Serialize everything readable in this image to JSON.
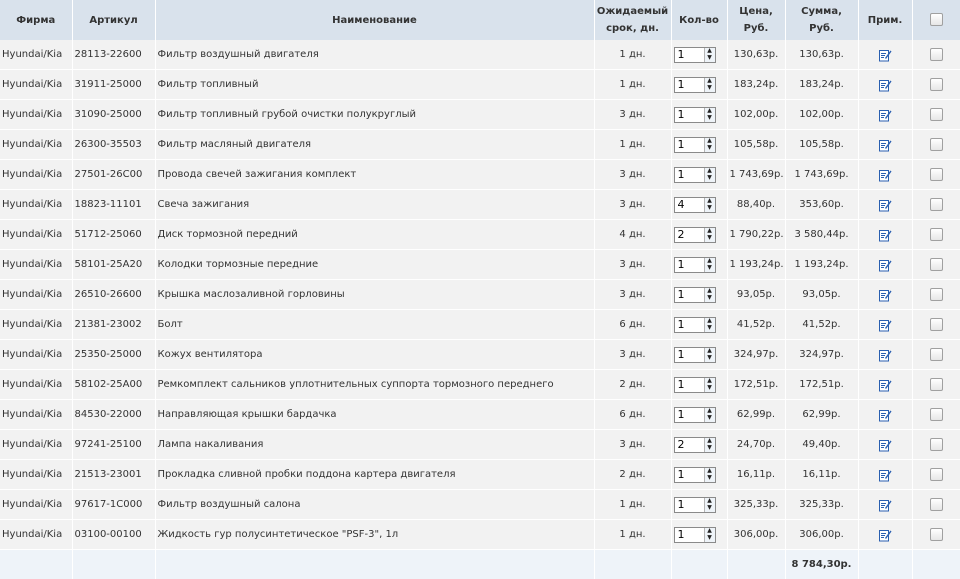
{
  "headers": {
    "firm": "Фирма",
    "article": "Артикул",
    "name": "Наименование",
    "days_line1": "Ожидаемый",
    "days_line2": "срок, дн.",
    "qty": "Кол-во",
    "price_line1": "Цена,",
    "price_line2": "Руб.",
    "sum": "Сумма, Руб.",
    "note": "Прим."
  },
  "icons": {
    "note": "edit-note-icon",
    "stepper_up": "arrow-up-icon",
    "stepper_down": "arrow-down-icon"
  },
  "colors": {
    "header_bg": "#d9e2ec",
    "row_bg": "#f2f2f2",
    "footer_bg": "#eef3f9",
    "icon_blue": "#2a5fb0"
  },
  "rows": [
    {
      "firm": "Hyundai/Kia",
      "article": "28113-22600",
      "name": "Фильтр воздушный двигателя",
      "days": "1 дн.",
      "qty": "1",
      "price": "130,63р.",
      "sum": "130,63р."
    },
    {
      "firm": "Hyundai/Kia",
      "article": "31911-25000",
      "name": "Фильтр топливный",
      "days": "1 дн.",
      "qty": "1",
      "price": "183,24р.",
      "sum": "183,24р."
    },
    {
      "firm": "Hyundai/Kia",
      "article": "31090-25000",
      "name": "Фильтр топливный грубой очистки полукруглый",
      "days": "3 дн.",
      "qty": "1",
      "price": "102,00р.",
      "sum": "102,00р."
    },
    {
      "firm": "Hyundai/Kia",
      "article": "26300-35503",
      "name": "Фильтр масляный двигателя",
      "days": "1 дн.",
      "qty": "1",
      "price": "105,58р.",
      "sum": "105,58р."
    },
    {
      "firm": "Hyundai/Kia",
      "article": "27501-26C00",
      "name": "Провода свечей зажигания комплект",
      "days": "3 дн.",
      "qty": "1",
      "price": "1 743,69р.",
      "sum": "1 743,69р."
    },
    {
      "firm": "Hyundai/Kia",
      "article": "18823-11101",
      "name": "Свеча зажигания",
      "days": "3 дн.",
      "qty": "4",
      "price": "88,40р.",
      "sum": "353,60р."
    },
    {
      "firm": "Hyundai/Kia",
      "article": "51712-25060",
      "name": "Диск тормозной передний",
      "days": "4 дн.",
      "qty": "2",
      "price": "1 790,22р.",
      "sum": "3 580,44р."
    },
    {
      "firm": "Hyundai/Kia",
      "article": "58101-25A20",
      "name": "Колодки тормозные передние",
      "days": "3 дн.",
      "qty": "1",
      "price": "1 193,24р.",
      "sum": "1 193,24р."
    },
    {
      "firm": "Hyundai/Kia",
      "article": "26510-26600",
      "name": "Крышка маслозаливной горловины",
      "days": "3 дн.",
      "qty": "1",
      "price": "93,05р.",
      "sum": "93,05р."
    },
    {
      "firm": "Hyundai/Kia",
      "article": "21381-23002",
      "name": "Болт",
      "days": "6 дн.",
      "qty": "1",
      "price": "41,52р.",
      "sum": "41,52р."
    },
    {
      "firm": "Hyundai/Kia",
      "article": "25350-25000",
      "name": "Кожух вентилятора",
      "days": "3 дн.",
      "qty": "1",
      "price": "324,97р.",
      "sum": "324,97р."
    },
    {
      "firm": "Hyundai/Kia",
      "article": "58102-25A00",
      "name": "Ремкомплект сальников уплотнительных суппорта тормозного переднего",
      "days": "2 дн.",
      "qty": "1",
      "price": "172,51р.",
      "sum": "172,51р."
    },
    {
      "firm": "Hyundai/Kia",
      "article": "84530-22000",
      "name": "Направляющая крышки бардачка",
      "days": "6 дн.",
      "qty": "1",
      "price": "62,99р.",
      "sum": "62,99р."
    },
    {
      "firm": "Hyundai/Kia",
      "article": "97241-25100",
      "name": "Лампа накаливания",
      "days": "3 дн.",
      "qty": "2",
      "price": "24,70р.",
      "sum": "49,40р."
    },
    {
      "firm": "Hyundai/Kia",
      "article": "21513-23001",
      "name": "Прокладка сливной пробки поддона картера двигателя",
      "days": "2 дн.",
      "qty": "1",
      "price": "16,11р.",
      "sum": "16,11р."
    },
    {
      "firm": "Hyundai/Kia",
      "article": "97617-1C000",
      "name": "Фильтр воздушный салона",
      "days": "1 дн.",
      "qty": "1",
      "price": "325,33р.",
      "sum": "325,33р."
    },
    {
      "firm": "Hyundai/Kia",
      "article": "03100-00100",
      "name": "Жидкость гур полусинтетическое \"PSF-3\", 1л",
      "days": "1 дн.",
      "qty": "1",
      "price": "306,00р.",
      "sum": "306,00р."
    }
  ],
  "footer": {
    "total": "8 784,30р."
  }
}
